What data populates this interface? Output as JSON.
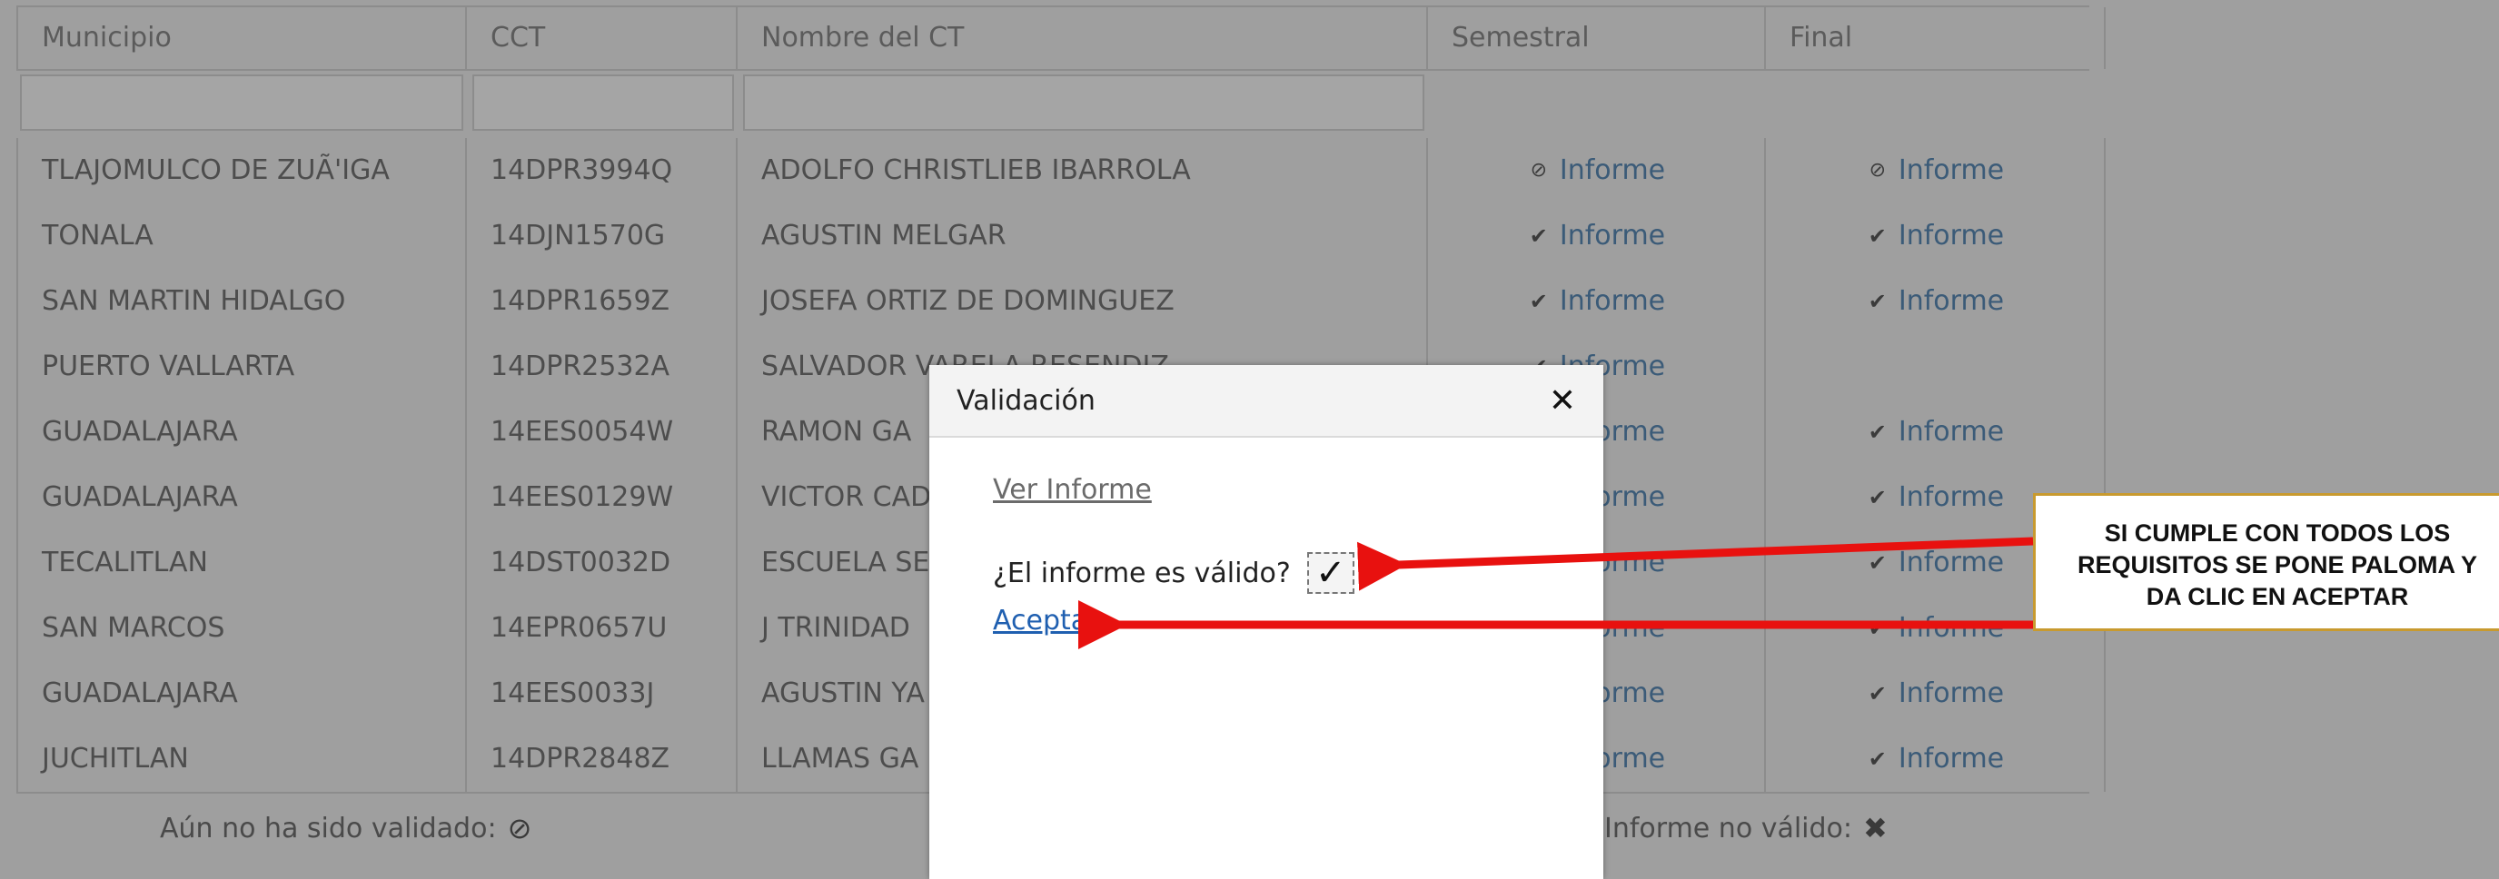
{
  "table": {
    "headers": [
      "Municipio",
      "CCT",
      "Nombre del CT",
      "Semestral",
      "Final"
    ],
    "rows": [
      {
        "municipio": "TLAJOMULCO DE ZUÃ'IGA",
        "cct": "14DPR3994Q",
        "nombre": "ADOLFO CHRISTLIEB IBARROLA",
        "semestral": {
          "icon": "blocked-icon",
          "label": "Informe"
        },
        "final": {
          "icon": "blocked-icon",
          "label": "Informe"
        }
      },
      {
        "municipio": "TONALA",
        "cct": "14DJN1570G",
        "nombre": "AGUSTIN MELGAR",
        "semestral": {
          "icon": "check-icon",
          "label": "Informe"
        },
        "final": {
          "icon": "check-icon",
          "label": "Informe"
        }
      },
      {
        "municipio": "SAN MARTIN HIDALGO",
        "cct": "14DPR1659Z",
        "nombre": "JOSEFA ORTIZ DE DOMINGUEZ",
        "semestral": {
          "icon": "check-icon",
          "label": "Informe"
        },
        "final": {
          "icon": "check-icon",
          "label": "Informe"
        }
      },
      {
        "municipio": "PUERTO VALLARTA",
        "cct": "14DPR2532A",
        "nombre": "SALVADOR VARELA RESENDIZ",
        "semestral": {
          "icon": "check-icon",
          "label": "Informe"
        },
        "final": null
      },
      {
        "municipio": "GUADALAJARA",
        "cct": "14EES0054W",
        "nombre": "RAMON GA",
        "semestral": {
          "icon": "check-icon",
          "label": "Informe"
        },
        "final": {
          "icon": "check-icon",
          "label": "Informe"
        }
      },
      {
        "municipio": "GUADALAJARA",
        "cct": "14EES0129W",
        "nombre": "VICTOR CAD",
        "semestral": {
          "icon": "check-icon",
          "label": "Informe"
        },
        "final": {
          "icon": "check-icon",
          "label": "Informe"
        }
      },
      {
        "municipio": "TECALITLAN",
        "cct": "14DST0032D",
        "nombre": "ESCUELA SE",
        "semestral": {
          "icon": "check-icon",
          "label": "Informe"
        },
        "final": {
          "icon": "check-icon",
          "label": "Informe"
        }
      },
      {
        "municipio": "SAN MARCOS",
        "cct": "14EPR0657U",
        "nombre": "J TRINIDAD",
        "semestral": {
          "icon": "check-icon",
          "label": "Informe"
        },
        "final": {
          "icon": "check-icon",
          "label": "Informe"
        }
      },
      {
        "municipio": "GUADALAJARA",
        "cct": "14EES0033J",
        "nombre": "AGUSTIN YA",
        "semestral": {
          "icon": "check-icon",
          "label": "Informe"
        },
        "final": {
          "icon": "check-icon",
          "label": "Informe"
        }
      },
      {
        "municipio": "JUCHITLAN",
        "cct": "14DPR2848Z",
        "nombre": "LLAMAS GA",
        "semestral": {
          "icon": "check-icon",
          "label": "Informe"
        },
        "final": {
          "icon": "check-icon",
          "label": "Informe"
        }
      }
    ]
  },
  "legend": {
    "not_validated": "Aún no ha sido validado:",
    "not_valid": "Informe no válido:"
  },
  "modal": {
    "title": "Validación",
    "close_symbol": "✕",
    "ver_informe": "Ver Informe",
    "question": "¿El informe es válido?",
    "checkbox_mark": "✓",
    "checkbox_checked": true,
    "accept": "Aceptar"
  },
  "callout": {
    "text": "SI CUMPLE CON TODOS LOS REQUISITOS SE PONE PALOMA Y DA CLIC EN ACEPTAR"
  },
  "colors": {
    "arrow": "#e8110f",
    "link": "#1f5fb0",
    "callout_border": "#c89a2f"
  }
}
